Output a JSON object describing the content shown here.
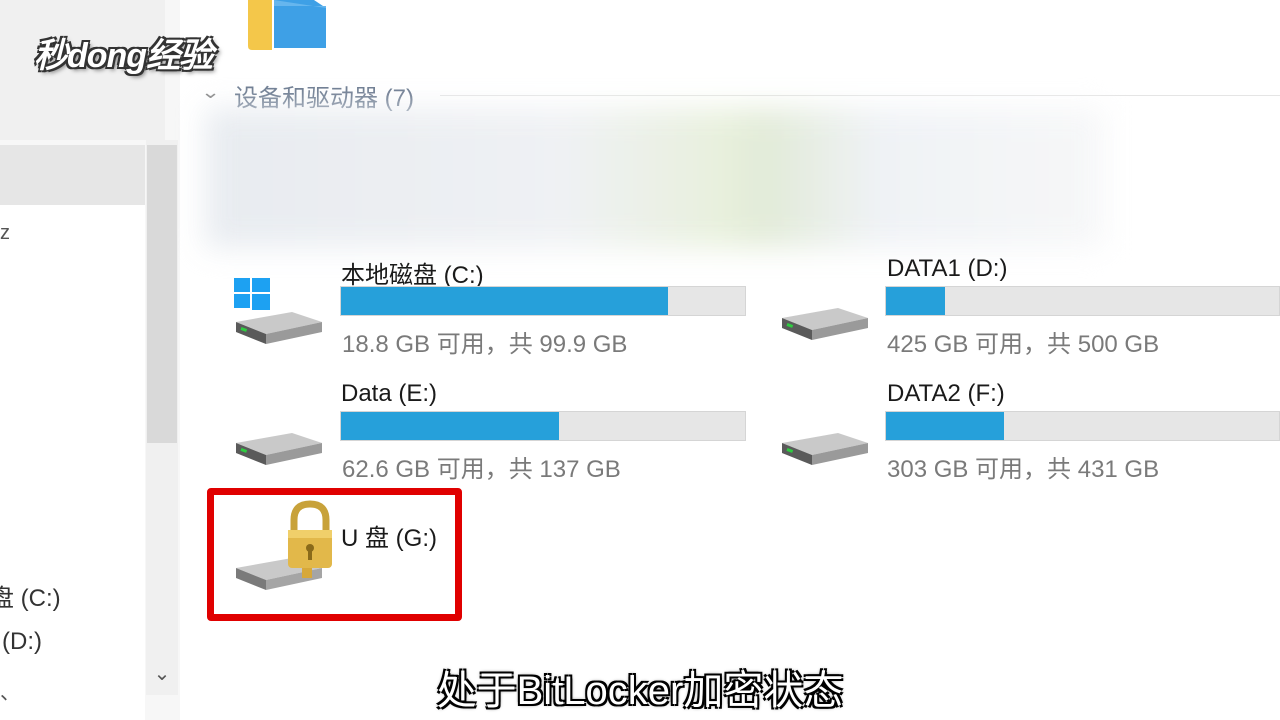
{
  "brand": {
    "logo_text": "秒dong经验"
  },
  "nav": {
    "stub_1": "z",
    "item_c": "盘 (C:)",
    "item_d": "(D:)",
    "stub_2": "、"
  },
  "section": {
    "title": "设备和驱动器 (7)"
  },
  "drives": [
    {
      "name": "本地磁盘 (C:)",
      "free_text": "18.8 GB 可用，共 99.9 GB",
      "used_fraction": 0.81,
      "icon": "windows-drive-icon"
    },
    {
      "name": "DATA1 (D:)",
      "free_text": "425 GB 可用，共 500 GB",
      "used_fraction": 0.15,
      "icon": "hard-drive-icon"
    },
    {
      "name": "Data (E:)",
      "free_text": "62.6 GB 可用，共 137 GB",
      "used_fraction": 0.54,
      "icon": "hard-drive-icon"
    },
    {
      "name": "DATA2 (F:)",
      "free_text": "303 GB 可用，共 431 GB",
      "used_fraction": 0.3,
      "icon": "hard-drive-icon"
    },
    {
      "name": "U 盘 (G:)",
      "icon": "locked-drive-icon"
    }
  ],
  "caption": {
    "text": "处于BitLocker加密状态"
  },
  "colors": {
    "bar_fill": "#26a0da",
    "bar_track": "#e6e6e6",
    "highlight": "#e00000"
  }
}
